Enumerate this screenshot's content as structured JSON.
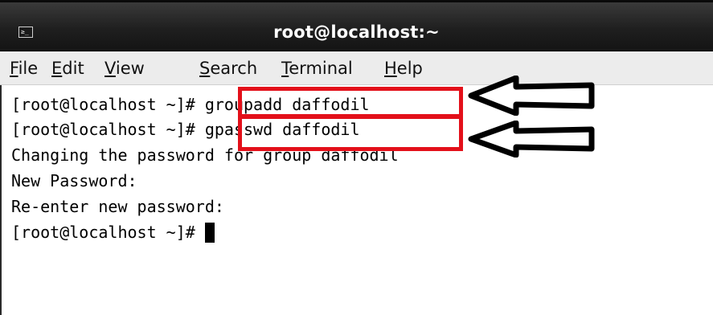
{
  "window": {
    "title": "root@localhost:~",
    "icon": "terminal-icon",
    "icon_glyph": "≥_"
  },
  "menu": {
    "items": [
      {
        "mnemonic": "F",
        "rest": "ile"
      },
      {
        "mnemonic": "E",
        "rest": "dit"
      },
      {
        "mnemonic": "V",
        "rest": "iew"
      },
      {
        "mnemonic": "S",
        "rest": "earch"
      },
      {
        "mnemonic": "T",
        "rest": "erminal"
      },
      {
        "mnemonic": "H",
        "rest": "elp"
      }
    ]
  },
  "terminal": {
    "lines": [
      {
        "prompt": "[root@localhost ~]# ",
        "command": "groupadd daffodil"
      },
      {
        "prompt": "[root@localhost ~]# ",
        "command": "gpasswd daffodil"
      },
      {
        "text": "Changing the password for group daffodil"
      },
      {
        "text": "New Password:"
      },
      {
        "text": "Re-enter new password:"
      },
      {
        "prompt": "[root@localhost ~]# ",
        "command": ""
      }
    ]
  },
  "annotations": {
    "highlight_color": "#e3101a",
    "arrow_color": "#000000"
  }
}
